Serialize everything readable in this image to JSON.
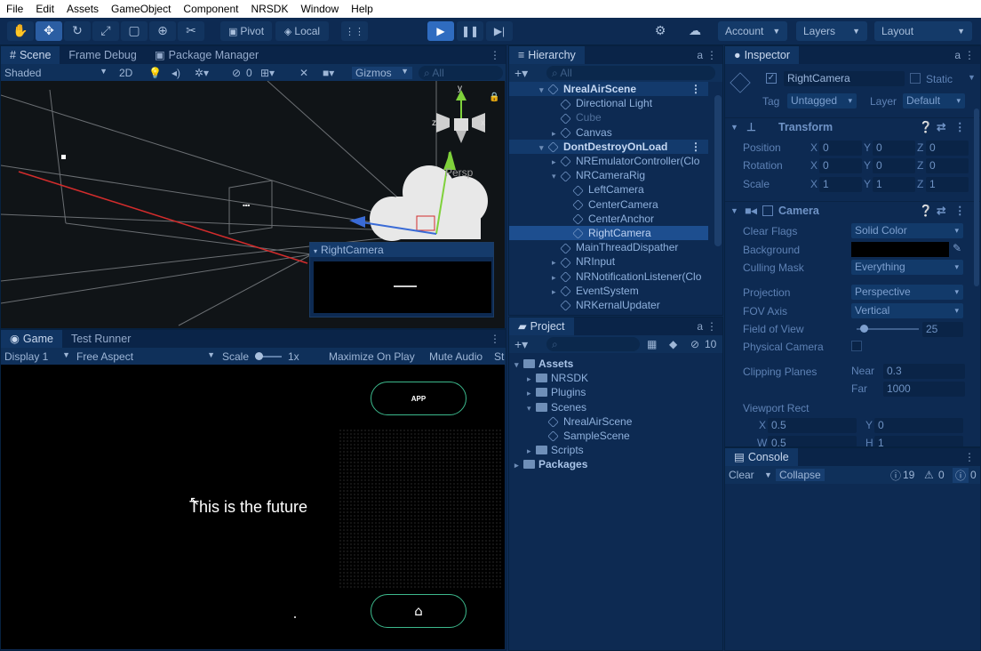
{
  "menu": [
    "File",
    "Edit",
    "Assets",
    "GameObject",
    "Component",
    "NRSDK",
    "Window",
    "Help"
  ],
  "toolbar": {
    "pivot": "Pivot",
    "local": "Local",
    "account": "Account",
    "layers": "Layers",
    "layout": "Layout"
  },
  "scene_panel": {
    "tabs": [
      "Scene",
      "Frame Debug",
      "Package Manager"
    ],
    "shading": "Shaded",
    "mode_2d": "2D",
    "gizmos": "Gizmos",
    "search_placeholder": "All",
    "hidden_count": "0",
    "persp_label": "Persp",
    "overlay_title": "RightCamera"
  },
  "game_panel": {
    "tabs": [
      "Game",
      "Test Runner"
    ],
    "display": "Display 1",
    "aspect": "Free Aspect",
    "scale_label": "Scale",
    "scale_value": "1x",
    "maximize": "Maximize On Play",
    "mute": "Mute Audio",
    "stats_cut": "St",
    "app_button": "APP",
    "home_icon": "home-icon",
    "center_text": "This is the future"
  },
  "hierarchy": {
    "title": "Hierarchy",
    "search_placeholder": "All",
    "rows": [
      {
        "label": "NrealAirScene",
        "depth": 0,
        "type": "scene",
        "fold": "▾"
      },
      {
        "label": "Directional Light",
        "depth": 1,
        "type": "obj",
        "fold": ""
      },
      {
        "label": "Cube",
        "depth": 1,
        "type": "dim",
        "fold": ""
      },
      {
        "label": "Canvas",
        "depth": 1,
        "type": "obj",
        "fold": "▸"
      },
      {
        "label": "DontDestroyOnLoad",
        "depth": 0,
        "type": "scene",
        "fold": "▾"
      },
      {
        "label": "NREmulatorController(Clo",
        "depth": 1,
        "type": "obj",
        "fold": "▸"
      },
      {
        "label": "NRCameraRig",
        "depth": 1,
        "type": "obj",
        "fold": "▾"
      },
      {
        "label": "LeftCamera",
        "depth": 2,
        "type": "obj",
        "fold": ""
      },
      {
        "label": "CenterCamera",
        "depth": 2,
        "type": "obj",
        "fold": ""
      },
      {
        "label": "CenterAnchor",
        "depth": 2,
        "type": "obj",
        "fold": ""
      },
      {
        "label": "RightCamera",
        "depth": 2,
        "type": "sel",
        "fold": ""
      },
      {
        "label": "MainThreadDispather",
        "depth": 1,
        "type": "obj",
        "fold": ""
      },
      {
        "label": "NRInput",
        "depth": 1,
        "type": "obj",
        "fold": "▸"
      },
      {
        "label": "NRNotificationListener(Clo",
        "depth": 1,
        "type": "obj",
        "fold": "▸"
      },
      {
        "label": "EventSystem",
        "depth": 1,
        "type": "obj",
        "fold": "▸"
      },
      {
        "label": "NRKernalUpdater",
        "depth": 1,
        "type": "obj",
        "fold": ""
      }
    ]
  },
  "project": {
    "title": "Project",
    "hidden_count": "10",
    "rows": [
      {
        "label": "Assets",
        "depth": 0,
        "bold": true,
        "fold": "▾"
      },
      {
        "label": "NRSDK",
        "depth": 1,
        "bold": false,
        "fold": "▸"
      },
      {
        "label": "Plugins",
        "depth": 1,
        "bold": false,
        "fold": "▸"
      },
      {
        "label": "Scenes",
        "depth": 1,
        "bold": false,
        "fold": "▾"
      },
      {
        "label": "NrealAirScene",
        "depth": 2,
        "bold": false,
        "fold": ""
      },
      {
        "label": "SampleScene",
        "depth": 2,
        "bold": false,
        "fold": ""
      },
      {
        "label": "Scripts",
        "depth": 1,
        "bold": false,
        "fold": "▸"
      },
      {
        "label": "Packages",
        "depth": 0,
        "bold": true,
        "fold": "▸"
      }
    ]
  },
  "inspector": {
    "title": "Inspector",
    "object_name": "RightCamera",
    "static_label": "Static",
    "tag_label": "Tag",
    "tag_value": "Untagged",
    "layer_label": "Layer",
    "layer_value": "Default",
    "transform": {
      "title": "Transform",
      "position_label": "Position",
      "rotation_label": "Rotation",
      "scale_label": "Scale",
      "position": [
        "0",
        "0",
        "0"
      ],
      "rotation": [
        "0",
        "0",
        "0"
      ],
      "scale": [
        "1",
        "1",
        "1"
      ]
    },
    "camera": {
      "title": "Camera",
      "clear_flags_label": "Clear Flags",
      "clear_flags": "Solid Color",
      "background_label": "Background",
      "culling_label": "Culling Mask",
      "culling": "Everything",
      "projection_label": "Projection",
      "projection": "Perspective",
      "fov_axis_label": "FOV Axis",
      "fov_axis": "Vertical",
      "fov_label": "Field of View",
      "fov_value": "25",
      "physical_label": "Physical Camera",
      "clipping_label": "Clipping Planes",
      "near_label": "Near",
      "near": "0.3",
      "far_label": "Far",
      "far": "1000",
      "viewport_label": "Viewport Rect",
      "vx": "0.5",
      "vy": "0",
      "vw": "0.5",
      "vh": "1"
    }
  },
  "console": {
    "title": "Console",
    "clear": "Clear",
    "collapse": "Collapse",
    "info_count": "19",
    "warn_count": "0",
    "error_count": "0"
  },
  "colors": {
    "bg": "#0d2a52",
    "selection": "#1d4e8f",
    "accent_green": "#3cb88c"
  }
}
